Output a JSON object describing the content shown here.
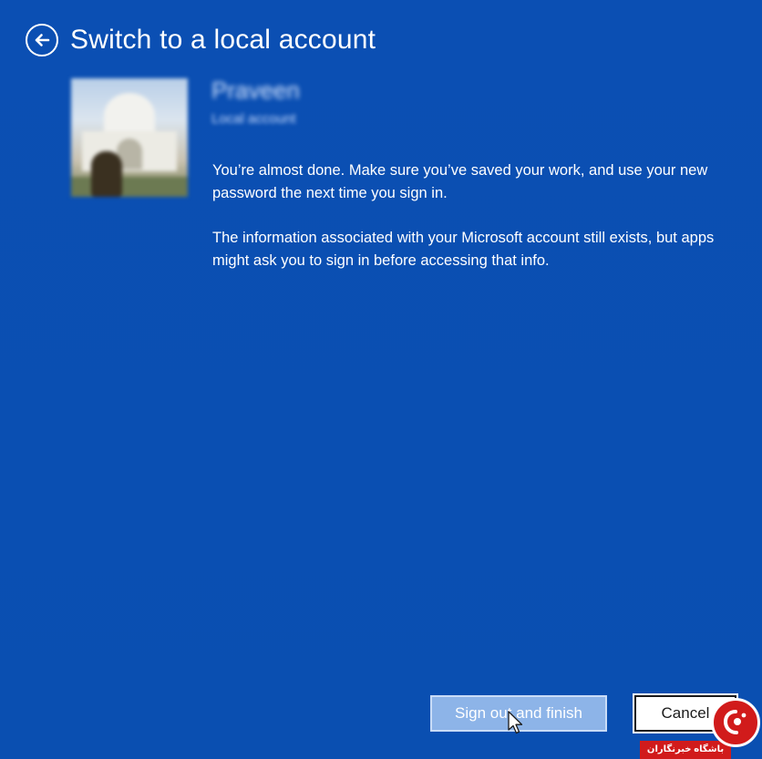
{
  "header": {
    "title": "Switch to a local account",
    "back_icon": "back-arrow-icon"
  },
  "user": {
    "name": "Praveen",
    "account_type": "Local account"
  },
  "messages": [
    "You’re almost done. Make sure you’ve saved your work, and use your new password the next time you sign in.",
    "The information associated with your Microsoft account still exists, but apps might ask you to sign in before accessing that info."
  ],
  "buttons": {
    "primary_label": "Sign out and finish",
    "cancel_label": "Cancel"
  },
  "watermark": {
    "text": "باشگاه خبرنگاران"
  },
  "colors": {
    "background": "#0b4fb2",
    "primary_button": "#8db4e8",
    "cancel_button": "#ffffff",
    "watermark_red": "#d11b1b"
  }
}
